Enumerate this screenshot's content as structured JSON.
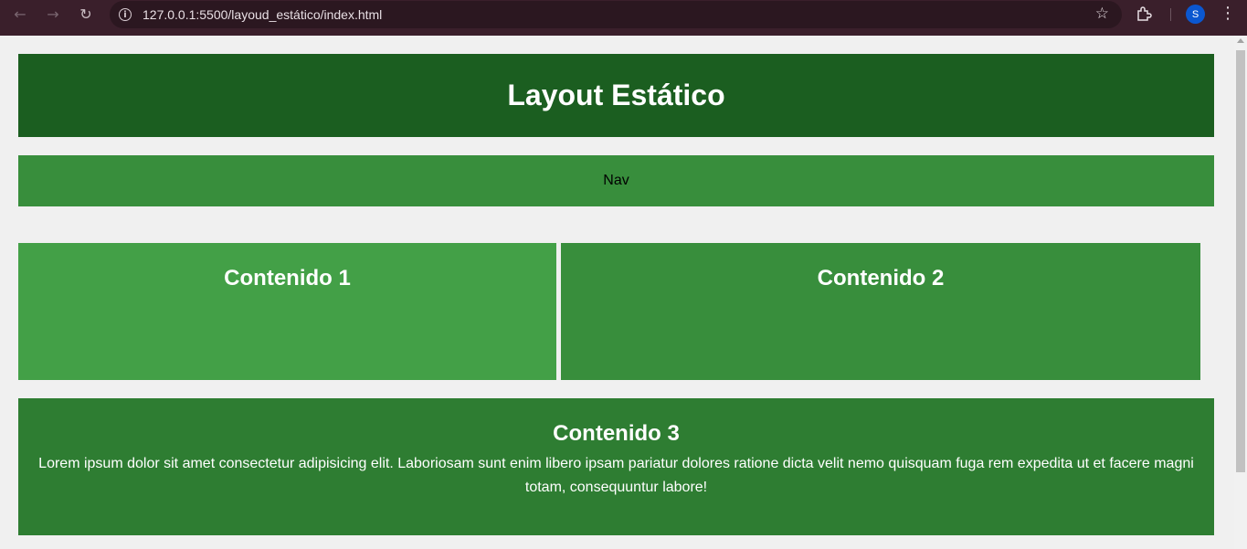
{
  "browser": {
    "url": "127.0.0.1:5500/layoud_estático/index.html",
    "back_icon": "arrow-left",
    "forward_icon": "arrow-right",
    "reload_icon": "reload",
    "info_icon": "i",
    "star_icon": "☆",
    "extensions_icon": "puzzle",
    "avatar_letter": "S",
    "avatar_color": "#0b57d0",
    "menu_icon": "⋮"
  },
  "header": {
    "title": "Layout Estático",
    "background": "#1b5e20"
  },
  "nav": {
    "label": "Nav",
    "background": "#388e3c"
  },
  "content1": {
    "title": "Contenido 1",
    "background": "#43a047"
  },
  "content2": {
    "title": "Contenido 2",
    "background": "#388e3c"
  },
  "content3": {
    "title": "Contenido 3",
    "text": "Lorem ipsum dolor sit amet consectetur adipisicing elit. Laboriosam sunt enim libero ipsam pariatur dolores ratione dicta velit nemo quisquam fuga rem expedita ut et facere magni totam, consequuntur labore!",
    "background": "#2e7d32"
  }
}
